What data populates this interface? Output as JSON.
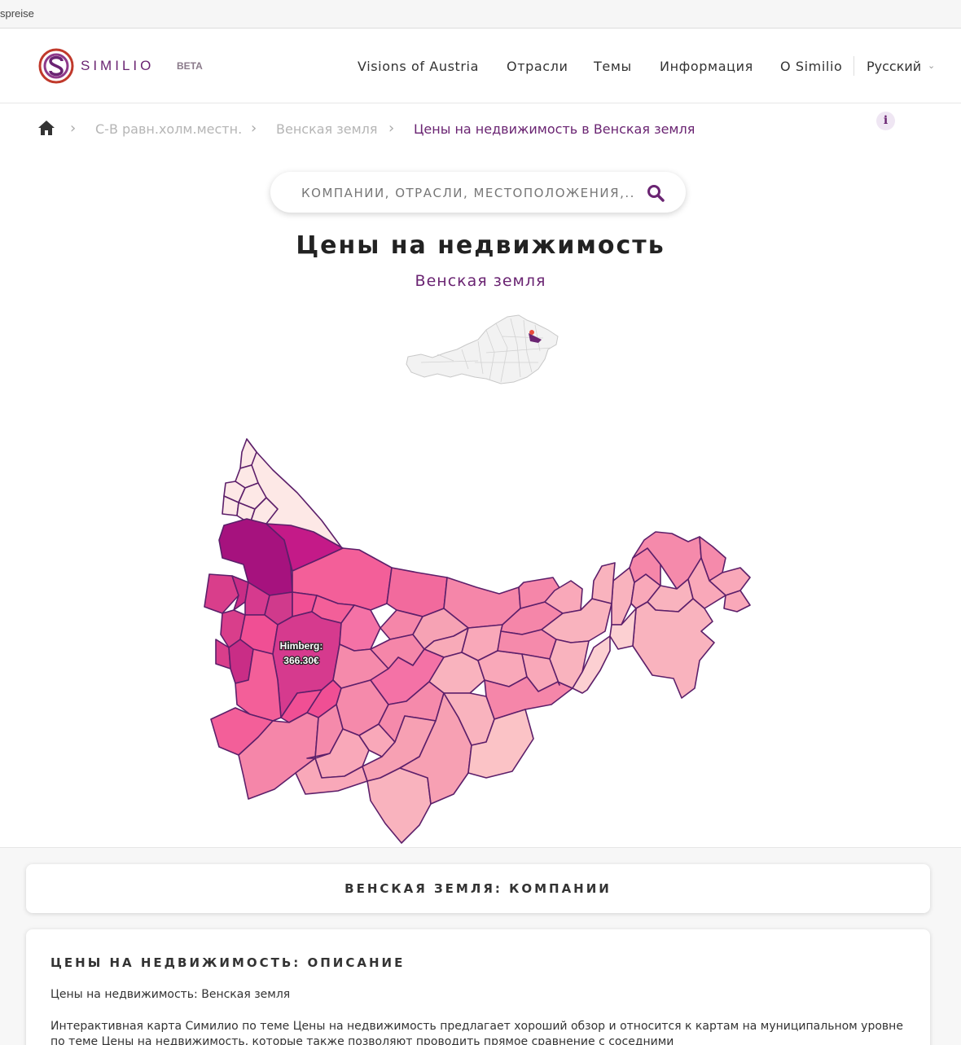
{
  "browser": {
    "tab_text": "spreise"
  },
  "header": {
    "brand": "SIMILIO",
    "beta": "BETA",
    "nav": [
      "Visions of Austria",
      "Отрасли",
      "Темы",
      "Информация",
      "O Similio"
    ],
    "language": "Русский"
  },
  "breadcrumb": {
    "items": [
      "С-В равн.холм.местн.",
      "Венская земля"
    ],
    "current": "Цены на недвижимость в Венская земля"
  },
  "search": {
    "placeholder": "КОМПАНИИ, ОТРАСЛИ, МЕСТОПОЛОЖЕНИЯ,..."
  },
  "page": {
    "title": "Цены на недвижимость",
    "subtitle": "Венская земля"
  },
  "map": {
    "tooltip_name": "Himberg:",
    "tooltip_value": "366.30€"
  },
  "colors": {
    "accent": "#6a2472",
    "map_border": "#5c1f6a"
  },
  "cards": {
    "companies_title": "ВЕНСКАЯ ЗЕМЛЯ: КОМПАНИИ",
    "description_title": "ЦЕНЫ НА НЕДВИЖИМОСТЬ: ОПИСАНИЕ",
    "description_line": "Цены на недвижимость: Венская земля",
    "description_text": "Интерактивная карта Симилио по теме Цены на недвижимость предлагает хороший обзор и относится к картам на муниципальном уровне по теме Цены на недвижимость, которые также позволяют проводить прямое сравнение с соседними"
  }
}
